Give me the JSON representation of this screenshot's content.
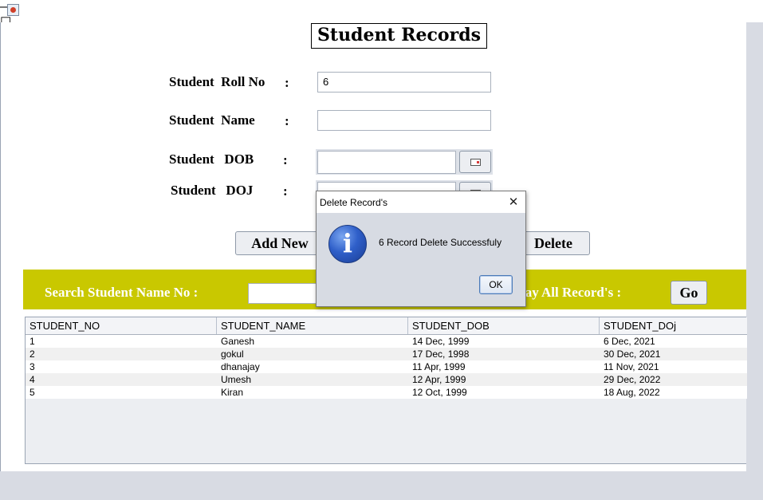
{
  "window": {
    "minimize_glyph": "—",
    "maximize_glyph": "☐",
    "close_glyph": "✕"
  },
  "form": {
    "title": "Student Records",
    "roll_label": "Student  Roll No",
    "name_label": "Student  Name",
    "dob_label": "Student   DOB",
    "doj_label": "Student   DOJ",
    "colon": ":",
    "roll_value": "6",
    "name_value": "",
    "dob_value": "",
    "doj_value": ""
  },
  "actions": {
    "add_label": "Add New",
    "delete_label": "Delete"
  },
  "search": {
    "name_label": "Search Student Name No :",
    "display_label": "lay All Record's :",
    "go_label": "Go"
  },
  "table": {
    "columns": [
      "STUDENT_NO",
      "STUDENT_NAME",
      "STUDENT_DOB",
      "STUDENT_DOj"
    ],
    "rows": [
      [
        "1",
        "Ganesh",
        "14 Dec, 1999",
        "6 Dec, 2021"
      ],
      [
        "2",
        "gokul",
        "17 Dec, 1998",
        "30 Dec, 2021"
      ],
      [
        "3",
        "dhanajay",
        "11 Apr, 1999",
        "11 Nov, 2021"
      ],
      [
        "4",
        "Umesh",
        "12 Apr, 1999",
        "29 Dec, 2022"
      ],
      [
        "5",
        "Kiran",
        "12 Oct, 1999",
        "18 Aug, 2022"
      ]
    ]
  },
  "dialog": {
    "title": "Delete Record's",
    "close_glyph": "✕",
    "message": "6 Record Delete Successfuly",
    "ok_label": "OK",
    "icon": "info-icon"
  }
}
